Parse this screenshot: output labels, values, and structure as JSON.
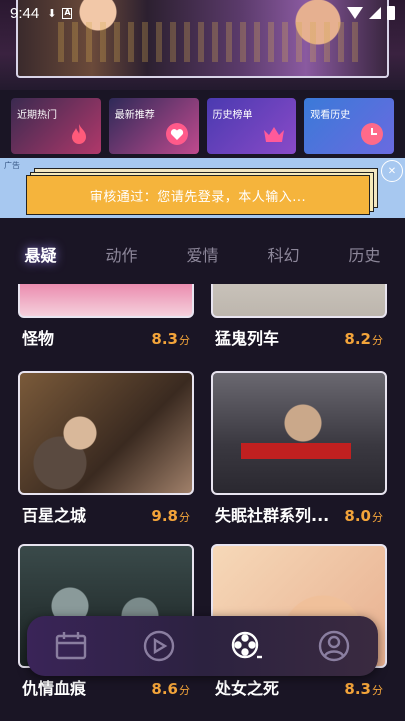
{
  "status_bar": {
    "time": "9:44",
    "icons": [
      "download-icon",
      "a-box-icon",
      "wifi-icon",
      "signal-icon",
      "battery-icon"
    ]
  },
  "categories": [
    {
      "label": "近期热门",
      "icon": "flame-icon"
    },
    {
      "label": "最新推荐",
      "icon": "heart-icon"
    },
    {
      "label": "历史榜单",
      "icon": "crown-icon"
    },
    {
      "label": "观看历史",
      "icon": "clock-icon"
    }
  ],
  "ad": {
    "tag": "广告",
    "text": "审核通过：您请先登录，本人输入..."
  },
  "tabs": [
    "悬疑",
    "动作",
    "爱情",
    "科幻",
    "历史"
  ],
  "active_tab": "悬疑",
  "movies": [
    {
      "title": "怪物",
      "score": "8.3",
      "unit": "分"
    },
    {
      "title": "猛鬼列车",
      "score": "8.2",
      "unit": "分"
    },
    {
      "title": "百星之城",
      "score": "9.8",
      "unit": "分"
    },
    {
      "title": "失眠社群系列...",
      "score": "8.0",
      "unit": "分"
    },
    {
      "title": "仇情血痕",
      "score": "8.6",
      "unit": "分"
    },
    {
      "title": "处女之死",
      "score": "8.3",
      "unit": "分"
    }
  ],
  "bottom_nav": [
    "calendar-icon",
    "play-icon",
    "film-reel-icon",
    "profile-icon"
  ],
  "colors": {
    "accent_score": "#f3a43a",
    "background": "#1a1525",
    "ad_box": "#f5b43c"
  }
}
